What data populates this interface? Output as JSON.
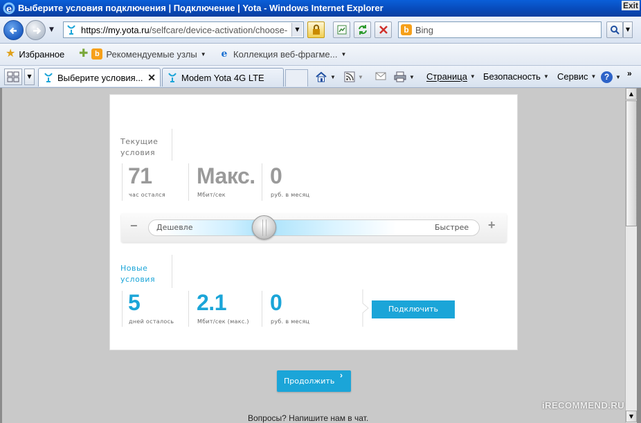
{
  "window": {
    "title": "Выберите условия подключения | Подключение | Yota - Windows Internet Explorer",
    "exit_label": "Exit"
  },
  "address": {
    "url_domain": "https://my.yota.ru",
    "url_path": "/selfcare/device-activation/choose-",
    "search_placeholder": "Bing"
  },
  "favorites": {
    "label": "Избранное",
    "suggested": "Рекомендуемые узлы",
    "gallery": "Коллекция веб-фрагме..."
  },
  "tabs": [
    {
      "label": "Выберите условия..."
    },
    {
      "label": "Modem Yota 4G LTE"
    }
  ],
  "commands": {
    "page": "Страница",
    "safety": "Безопасность",
    "tools": "Сервис"
  },
  "current": {
    "label_line1": "Текущие",
    "label_line2": "условия",
    "time_value": "71",
    "time_unit": "час остался",
    "speed_value": "Макс.",
    "speed_unit": "Мбит/сек",
    "price_value": "0",
    "price_unit": "руб. в месяц"
  },
  "slider": {
    "left_label": "Дешевле",
    "right_label": "Быстрее",
    "minus": "−",
    "plus": "+",
    "level_fraction": 0.35
  },
  "new": {
    "label_line1": "Новые",
    "label_line2": "условия",
    "time_value": "5",
    "time_unit": "дней осталось",
    "speed_value": "2.1",
    "speed_unit": "Мбит/сек (макс.)",
    "price_value": "0",
    "price_unit": "руб. в месяц"
  },
  "buttons": {
    "connect": "Подключить",
    "continue": "Продолжить"
  },
  "footer": {
    "chat_text": "Вопросы? Напишите нам в чат."
  },
  "watermark": "iRECOMMEND.RU",
  "colors": {
    "accent": "#1ba5d8",
    "title_bar": "#0849b8"
  }
}
